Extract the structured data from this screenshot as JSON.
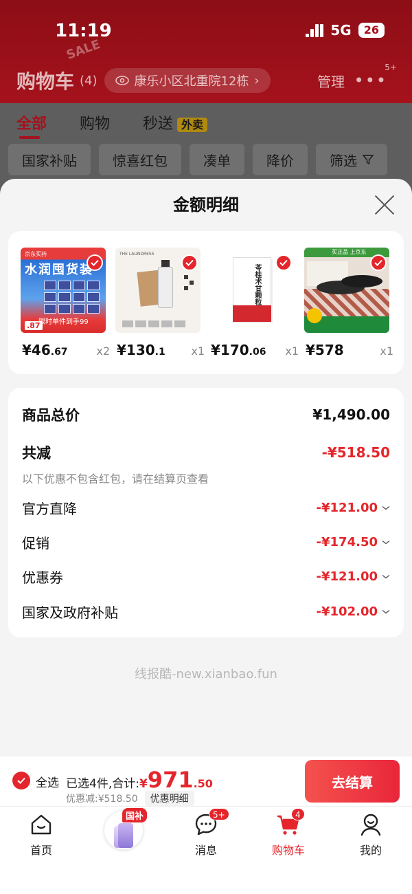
{
  "status_bar": {
    "time": "11:19",
    "network": "5G",
    "battery": "26"
  },
  "header": {
    "title": "购物车",
    "count": "(4)",
    "address": "康乐小区北重院12栋",
    "manage_label": "管理",
    "more_badge": "5+",
    "sale_deco": "SALE"
  },
  "tabs": [
    {
      "label": "全部"
    },
    {
      "label": "购物"
    },
    {
      "label": "秒送"
    }
  ],
  "takeaway_tag": "外卖",
  "filters": [
    {
      "label": "国家补贴"
    },
    {
      "label": "惊喜红包"
    },
    {
      "label": "凑单"
    },
    {
      "label": "降价"
    },
    {
      "label": "筛选"
    }
  ],
  "sheet": {
    "title": "金额明细",
    "products": [
      {
        "price_int": "¥46",
        "price_dec": ".67",
        "qty": "x2",
        "thumb_text": "水润囤货装",
        "thumb_sub": "京东买药",
        "thumb_foot": "限时单件到手99",
        "thumb_tag": ".87"
      },
      {
        "price_int": "¥130",
        "price_dec": ".1",
        "qty": "x1",
        "thumb_text": "THE LAUNDRESS"
      },
      {
        "price_int": "¥170",
        "price_dec": ".06",
        "qty": "x1",
        "thumb_text": "苓桂术甘颗粒"
      },
      {
        "price_int": "¥578",
        "price_dec": "",
        "qty": "x1",
        "thumb_text": "买正品 上京东"
      }
    ],
    "summary": {
      "total_label": "商品总价",
      "total_value": "¥1,490.00",
      "reduce_label": "共减",
      "reduce_value": "-¥518.50",
      "note": "以下优惠不包含红包，请在结算页查看",
      "items": [
        {
          "label": "官方直降",
          "value": "-¥121.00"
        },
        {
          "label": "促销",
          "value": "-¥174.50"
        },
        {
          "label": "优惠券",
          "value": "-¥121.00"
        },
        {
          "label": "国家及政府补贴",
          "value": "-¥102.00"
        }
      ]
    },
    "watermark": "线报酷-new.xianbao.fun"
  },
  "checkout": {
    "select_all": "全选",
    "selected_text": "已选4件,合计:",
    "currency": "¥",
    "amount_int": "971",
    "amount_dec": ".50",
    "discount_text": "优惠减:¥518.50",
    "detail_link": "优惠明细",
    "pay_button": "去结算"
  },
  "tabbar": [
    {
      "label": "首页",
      "icon": "home-icon"
    },
    {
      "label": "",
      "icon": "phone-promo-icon",
      "tag": "国补"
    },
    {
      "label": "消息",
      "icon": "message-icon",
      "badge": "5+"
    },
    {
      "label": "购物车",
      "icon": "cart-icon",
      "badge": "4"
    },
    {
      "label": "我的",
      "icon": "profile-icon"
    }
  ],
  "colors": {
    "brand_red": "#e4262c",
    "header_dark_red": "#a5121c"
  }
}
